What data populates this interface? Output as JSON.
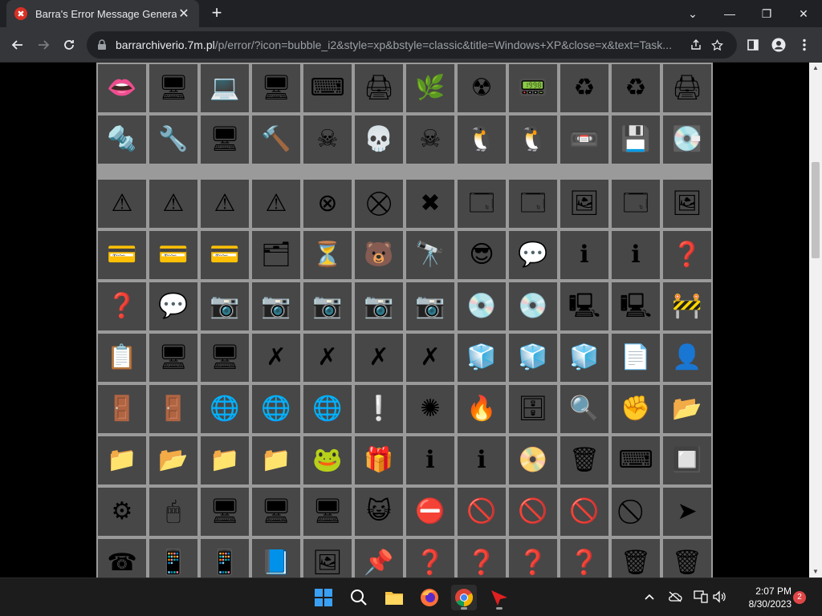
{
  "browser": {
    "tab_title": "Barra's Error Message Generator",
    "tab_favicon": "✖",
    "tab_close": "✕",
    "new_tab": "+",
    "url_host": "barrarchiverio.7m.pl",
    "url_path": "/p/error/?icon=bubble_i2&style=xp&bstyle=classic&title=Windows+XP&close=x&text=Task...",
    "win_minimize": "—",
    "win_restore": "❐",
    "win_close": "✕",
    "win_tabsearch": "⌄"
  },
  "icons": {
    "rows": [
      [
        "👄",
        "🖥",
        "💻",
        "🖥",
        "⌨",
        "🖨",
        "🌿",
        "☢",
        "📟",
        "♻",
        "♻",
        "🖨"
      ],
      [
        "🔩",
        "🔧",
        "🖥",
        "🔨",
        "☠",
        "💀",
        "☠",
        "🐧",
        "🐧",
        "📼",
        "💾",
        "💽"
      ],
      [
        "⚠",
        "⚠",
        "⚠",
        "⚠",
        "⊗",
        "⛒",
        "✖",
        "🗔",
        "🗔",
        "🖼",
        "🗔",
        "🖼"
      ],
      [
        "💳",
        "💳",
        "💳",
        "🗂",
        "⏳",
        "🐻",
        "🔭",
        "😎",
        "💬",
        "ℹ",
        "ℹ",
        "❓"
      ],
      [
        "❓",
        "💬",
        "📷",
        "📷",
        "📷",
        "📷",
        "📷",
        "💿",
        "💿",
        "🖳",
        "🖳",
        "🚧"
      ],
      [
        "📋",
        "🖥",
        "🖥",
        "✗",
        "✗",
        "✗",
        "✗",
        "🧊",
        "🧊",
        "🧊",
        "📄",
        "👤"
      ],
      [
        "🚪",
        "🚪",
        "🌐",
        "🌐",
        "🌐",
        "❕",
        "✺",
        "🔥",
        "🗄",
        "🔍",
        "✊",
        "📂"
      ],
      [
        "📁",
        "📂",
        "📁",
        "📁",
        "🐸",
        "🎁",
        "ℹ",
        "ℹ",
        "📀",
        "🗑",
        "⌨",
        "🔲"
      ],
      [
        "⚙",
        "🖱",
        "🖥",
        "🖥",
        "🖥",
        "😺",
        "⛔",
        "🚫",
        "🚫",
        "🚫",
        "⃠",
        "➤"
      ],
      [
        "☎",
        "📱",
        "📱",
        "📘",
        "🖼",
        "📌",
        "❓",
        "❓",
        "❓",
        "❓",
        "🗑",
        "🗑"
      ]
    ]
  },
  "taskbar": {
    "time": "2:07 PM",
    "date": "8/30/2023",
    "notification_count": "2"
  }
}
